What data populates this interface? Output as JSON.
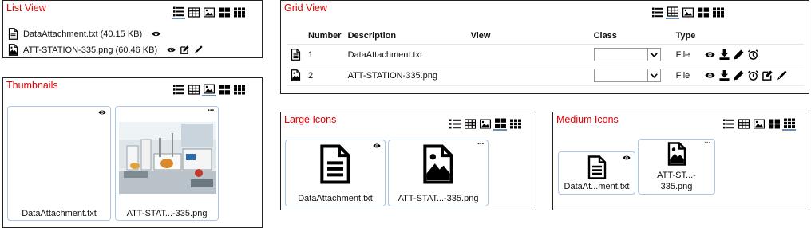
{
  "icon_names": {
    "views": [
      "list-view-icon",
      "grid-view-icon",
      "thumbnails-view-icon",
      "large-icons-view-icon",
      "medium-icons-view-icon"
    ],
    "file_txt": "document-icon",
    "file_png": "image-file-icon",
    "actions": [
      "eye-icon",
      "download-icon",
      "pencil-icon",
      "alarm-clock-icon",
      "edit-box-icon",
      "pen-icon"
    ]
  },
  "colors": {
    "title": "#e00000",
    "active_underline": "#6a8fb5",
    "card_border": "#a9c6e4"
  },
  "list_view": {
    "title": "List View",
    "items": [
      {
        "label": "DataAttachment.txt (40.15 KB)"
      },
      {
        "label": "ATT-STATION-335.png (60.46 KB)"
      }
    ]
  },
  "grid_view": {
    "title": "Grid View",
    "headers": {
      "number": "Number",
      "description": "Description",
      "view": "View",
      "class": "Class",
      "type": "Type"
    },
    "rows": [
      {
        "number": "1",
        "description": "DataAttachment.txt",
        "type": "File"
      },
      {
        "number": "2",
        "description": "ATT-STATION-335.png",
        "type": "File"
      }
    ]
  },
  "thumbnails": {
    "title": "Thumbnails",
    "items": [
      {
        "label": "DataAttachment.txt"
      },
      {
        "label": "ATT-STAT...-335.png"
      }
    ]
  },
  "large_icons": {
    "title": "Large Icons",
    "items": [
      {
        "label": "DataAttachment.txt"
      },
      {
        "label": "ATT-STAT...-335.png"
      }
    ]
  },
  "medium_icons": {
    "title": "Medium Icons",
    "items": [
      {
        "label": "DataAt...ment.txt"
      },
      {
        "label_line1": "ATT-ST...-",
        "label_line2": "335.png"
      }
    ]
  },
  "menu_glyph": "···"
}
